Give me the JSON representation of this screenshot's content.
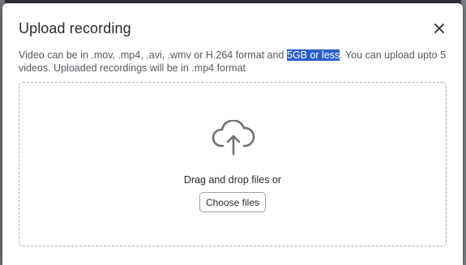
{
  "dialog": {
    "title": "Upload recording",
    "close_icon": "close-icon",
    "description": {
      "before": "Video can be in .mov, .mp4, .avi, .wmv or H.264 format and ",
      "highlighted": "5GB or less",
      "after": ". You can upload upto 5 videos. Uploaded recordings will be in .mp4 format"
    },
    "dropzone": {
      "icon": "cloud-upload-icon",
      "text": "Drag and drop files or",
      "button_label": "Choose files"
    }
  },
  "colors": {
    "highlight": "#2a60c9",
    "text_primary": "#2b2b2b",
    "text_secondary": "#555a60",
    "border": "#a9adb3"
  }
}
